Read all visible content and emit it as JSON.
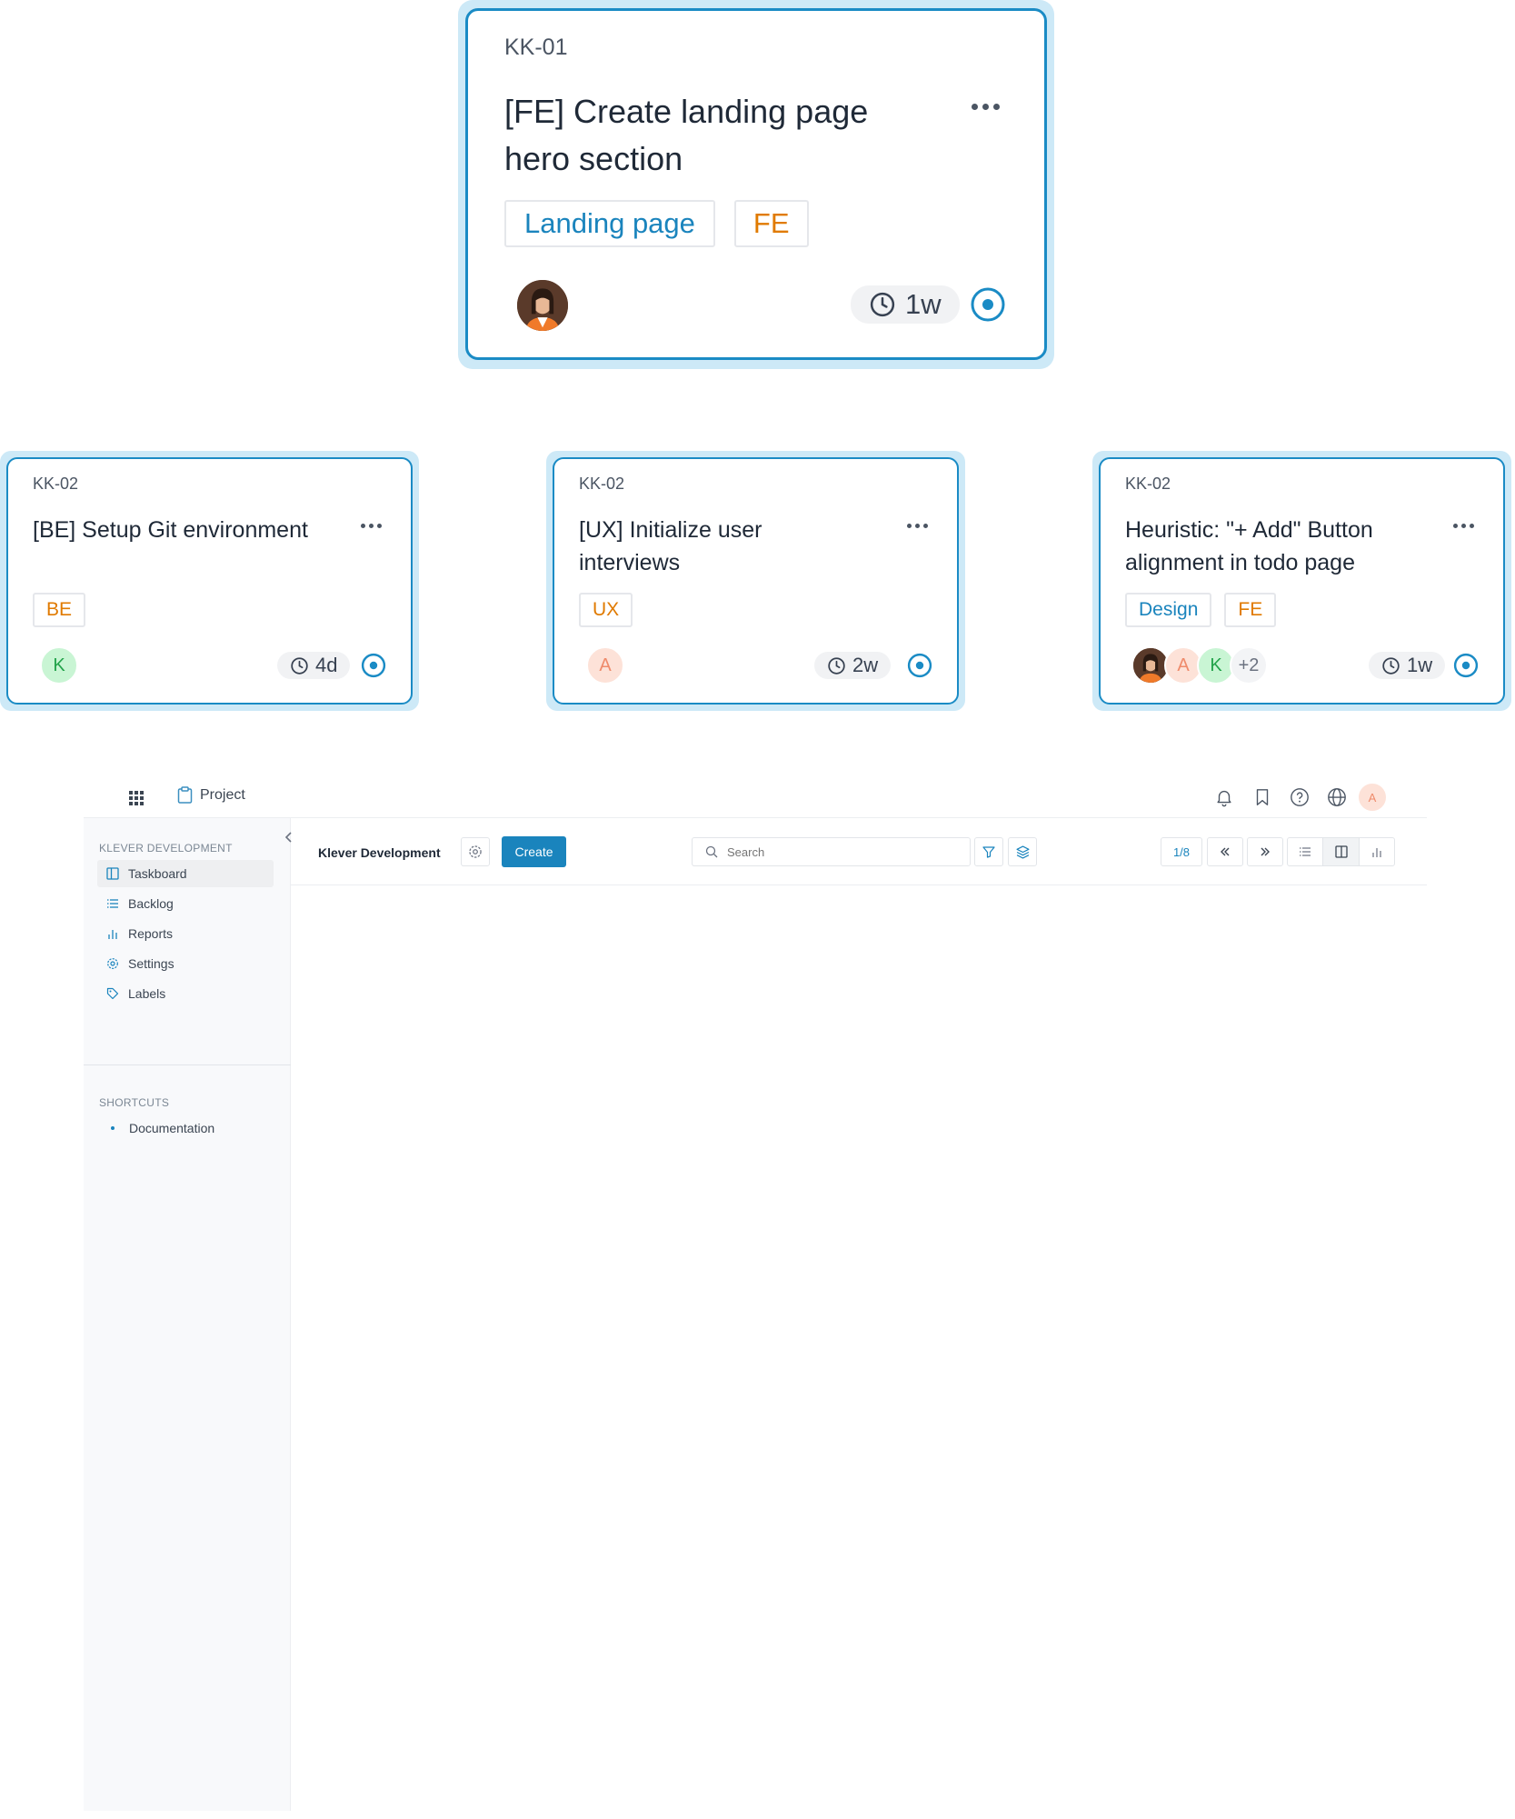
{
  "cards": [
    {
      "id": "KK-01",
      "title_line1": "[FE] Create landing page",
      "title_line2": "hero section",
      "tags": [
        {
          "label": "Landing page",
          "color": "#1a84bd"
        },
        {
          "label": "FE",
          "color": "#e07a00"
        }
      ],
      "assignees": [
        "photo"
      ],
      "estimate": "1w"
    },
    {
      "id": "KK-02",
      "title_line1": "[BE] Setup Git environment",
      "title_line2": "",
      "tags": [
        {
          "label": "BE",
          "color": "#e07a00"
        }
      ],
      "assignees": [
        {
          "initial": "K"
        }
      ],
      "estimate": "4d"
    },
    {
      "id": "KK-02",
      "title_line1": "[UX] Initialize user",
      "title_line2": "interviews",
      "tags": [
        {
          "label": "UX",
          "color": "#e07a00"
        }
      ],
      "assignees": [
        {
          "initial": "A"
        }
      ],
      "estimate": "2w"
    },
    {
      "id": "KK-02",
      "title_line1": "Heuristic: \"+ Add\" Button",
      "title_line2": "alignment in todo page",
      "tags": [
        {
          "label": "Design",
          "color": "#1a84bd"
        },
        {
          "label": "FE",
          "color": "#e07a00"
        }
      ],
      "assignees": [
        {
          "initial": "A"
        },
        {
          "initial": "K"
        },
        {
          "initial": "+2"
        }
      ],
      "estimate": "1w"
    }
  ],
  "app": {
    "topbar": {
      "project_label": "Project",
      "user_initial": "A"
    },
    "sidebar": {
      "section_title": "KLEVER DEVELOPMENT",
      "items": [
        {
          "label": "Taskboard",
          "icon": "board-icon"
        },
        {
          "label": "Backlog",
          "icon": "list-icon"
        },
        {
          "label": "Reports",
          "icon": "chart-icon"
        },
        {
          "label": "Settings",
          "icon": "gear-icon"
        },
        {
          "label": "Labels",
          "icon": "tag-icon"
        }
      ],
      "shortcuts_title": "SHORTCUTS",
      "shortcuts": [
        {
          "label": "Documentation"
        }
      ]
    },
    "header": {
      "project_name": "Klever Development",
      "create_label": "Create",
      "search_placeholder": "Search",
      "page_indicator": "1/8"
    }
  },
  "colors": {
    "accent": "#1a8bc5",
    "tag_blue": "#1a84bd",
    "tag_orange": "#e07a00",
    "halo": "#cde9f7"
  }
}
